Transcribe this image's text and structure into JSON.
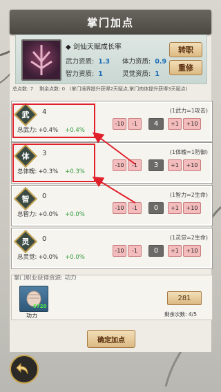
{
  "title": "掌门加点",
  "header": {
    "name": "◆ 剑仙天赋成长率",
    "stats": [
      {
        "label": "武力资质:",
        "value": "1.3"
      },
      {
        "label": "体力资质:",
        "value": "0.9"
      },
      {
        "label": "智力资质:",
        "value": "1"
      },
      {
        "label": "灵觉资质:",
        "value": "1"
      }
    ],
    "transfer_button": "转职",
    "repair_button": "重修"
  },
  "points": {
    "total_label": "总点数:",
    "total": "7",
    "remain_label": "剩余点数:",
    "remain": "0",
    "note": "(掌门境界提升获得2天赋点,掌门肉体提升获得3天赋点)"
  },
  "attributes": [
    {
      "icon": "wu",
      "glyph": "武",
      "value": "4",
      "rate": "(1武力=1攻击)",
      "total_label": "总武力:",
      "total": "+0.4%",
      "bonus": "+0.4%",
      "current": "4"
    },
    {
      "icon": "ti",
      "glyph": "体",
      "value": "3",
      "rate": "(1体魄=1防御)",
      "total_label": "总体魄:",
      "total": "+0.3%",
      "bonus": "+0.3%",
      "current": "3"
    },
    {
      "icon": "zhi",
      "glyph": "智",
      "value": "0",
      "rate": "(1智力=2生命)",
      "total_label": "总智力:",
      "total": "+0.0%",
      "bonus": "+0.0%",
      "current": "0"
    },
    {
      "icon": "ling",
      "glyph": "灵",
      "value": "0",
      "rate": "(1灵觉=2生命)",
      "total_label": "总灵觉:",
      "total": "+0.0%",
      "bonus": "+0.0%",
      "current": "0"
    }
  ],
  "controls": {
    "m10": "-10",
    "m1": "-1",
    "p1": "+1",
    "p10": "+10"
  },
  "resource": {
    "label": "掌门职业获得资源: 功力",
    "item_count": "5720",
    "item_name": "功力",
    "amount": "281",
    "remain": "剩余次数: 4/5"
  },
  "confirm_button": "确定加点"
}
